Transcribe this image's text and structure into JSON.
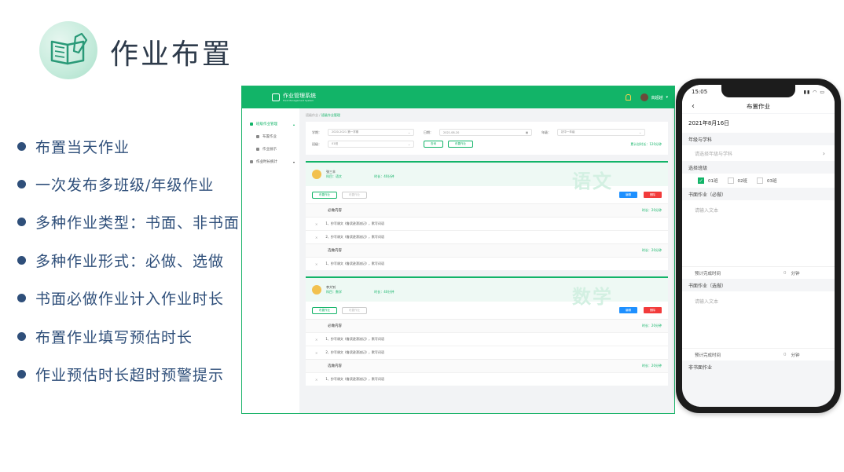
{
  "slide": {
    "title": "作业布置",
    "bullets": [
      "布置当天作业",
      "一次发布多班级/年级作业",
      "多种作业类型：书面、非书面",
      "多种作业形式：必做、选做",
      "书面必做作业计入作业时长",
      "布置作业填写预估时长",
      "作业预估时长超时预警提示"
    ]
  },
  "colors": {
    "brand": "#12b468",
    "bullet": "#2f4f7a",
    "blue": "#1e90ff",
    "red": "#f23b3b"
  },
  "desktop": {
    "app_name": "作业管理系统",
    "app_name_en": "Hwk Management System",
    "user_name": "高超越",
    "sidebar": [
      {
        "label": "班级作业管理",
        "icon": "gear-icon"
      },
      {
        "label": "布置作业",
        "icon": "doc-icon"
      },
      {
        "label": "作业展示",
        "icon": "doc-icon"
      },
      {
        "label": "作业时长统计",
        "icon": "chart-icon"
      }
    ],
    "breadcrumb": {
      "root": "班级作业 /",
      "current": "班级作业管理"
    },
    "filters": {
      "term_label": "学期：",
      "term_value": "2020-2021 第一学期",
      "date_label": "日期：",
      "date_value": "2021-08-20",
      "grade_label": "年级：",
      "grade_value": "初中一年级",
      "class_label": "班级：",
      "class_value": "01班",
      "query_button": "查询",
      "publish_button": "布置作业",
      "total": "累计总时长：120分钟"
    },
    "cards": [
      {
        "teacher": "张三丰",
        "subject": "科目：语文",
        "duration": "时长：40分钟",
        "watermark": "语文",
        "action_a": "布置作业",
        "action_b": "布置作业",
        "edit": "编辑",
        "delete": "删除",
        "required_title": "必做内容",
        "required_duration": "时长：20分钟",
        "required": [
          "1、抄写课文《鲁滨逊漂流记》，默写词语",
          "2、抄写课文《鲁滨逊漂流记》，默写词语"
        ],
        "optional_title": "选做内容",
        "optional_duration": "时长：20分钟",
        "optional": [
          "1、抄写课文《鲁滨逊漂流记》，默写词语"
        ]
      },
      {
        "teacher": "李大钊",
        "subject": "科目：数学",
        "duration": "时长：40分钟",
        "watermark": "数学",
        "action_a": "布置作业",
        "action_b": "布置作业",
        "edit": "编辑",
        "delete": "删除",
        "required_title": "必做内容",
        "required_duration": "时长：20分钟",
        "required": [
          "1、抄写课文《鲁滨逊漂流记》，默写词语",
          "2、抄写课文《鲁滨逊漂流记》，默写词语"
        ],
        "optional_title": "选做内容",
        "optional_duration": "时长：20分钟",
        "optional": [
          "1、抄写课文《鲁滨逊漂流记》，默写词语"
        ]
      }
    ]
  },
  "phone": {
    "time": "15:05",
    "nav_title": "布置作业",
    "date": "2021年8月16日",
    "grade_subject_label": "年级与学科",
    "grade_subject_placeholder": "请选择年级与学科",
    "class_label": "选择班级",
    "classes": [
      {
        "name": "01班",
        "checked": true
      },
      {
        "name": "02班",
        "checked": false
      },
      {
        "name": "03班",
        "checked": false
      }
    ],
    "written_required_label": "书面作业（必做）",
    "text_placeholder": "请输入文本",
    "estimate_label": "预计完成时间",
    "estimate_value": "0",
    "estimate_unit": "分钟",
    "written_optional_label": "书面作业（选做）",
    "non_written_label": "非书面作业"
  }
}
